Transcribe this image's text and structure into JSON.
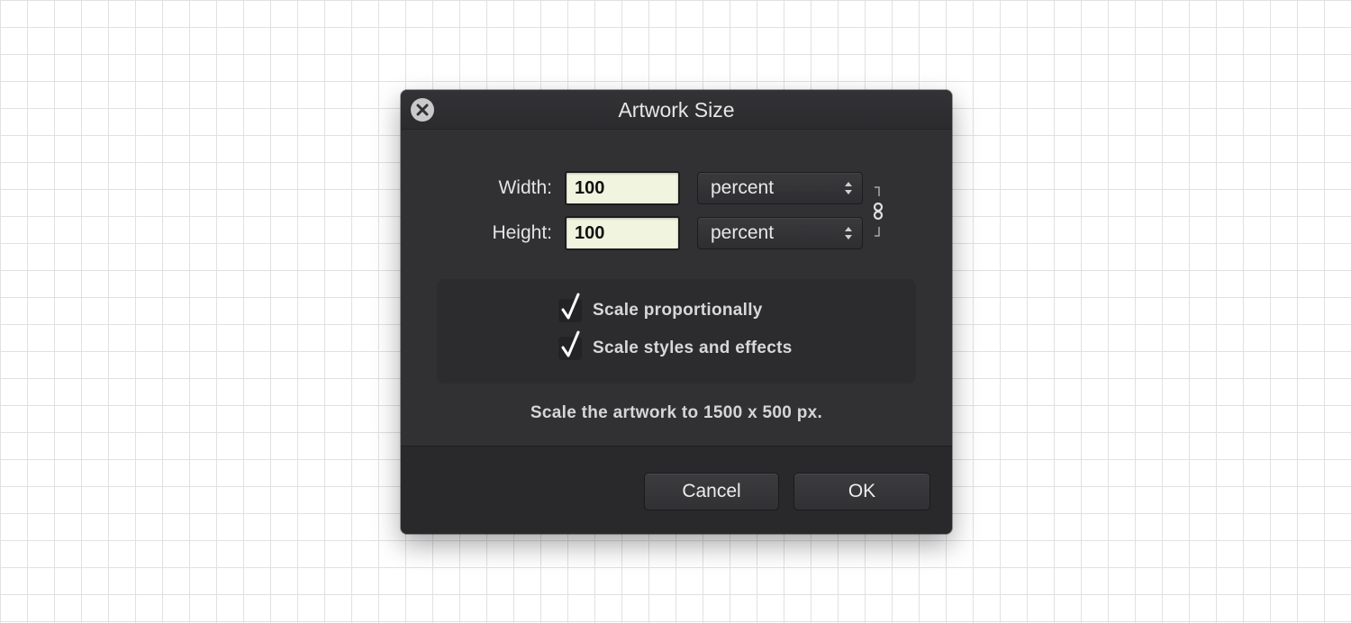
{
  "dialog": {
    "title": "Artwork Size",
    "close_icon": "close-x-icon"
  },
  "dimensions": {
    "width_label": "Width:",
    "width_value": "100",
    "width_unit": "percent",
    "height_label": "Height:",
    "height_value": "100",
    "height_unit": "percent",
    "constrain_icon": "chain-link-icon"
  },
  "options": {
    "scale_proportionally": {
      "label": "Scale proportionally",
      "checked": true
    },
    "scale_styles": {
      "label": "Scale styles and effects",
      "checked": true
    }
  },
  "info_text": "Scale the artwork to 1500 x 500 px.",
  "buttons": {
    "cancel": "Cancel",
    "ok": "OK"
  },
  "colors": {
    "dialog_bg": "#313134",
    "field_bg": "#f1f4de",
    "grid_line": "#e1e1e1"
  }
}
